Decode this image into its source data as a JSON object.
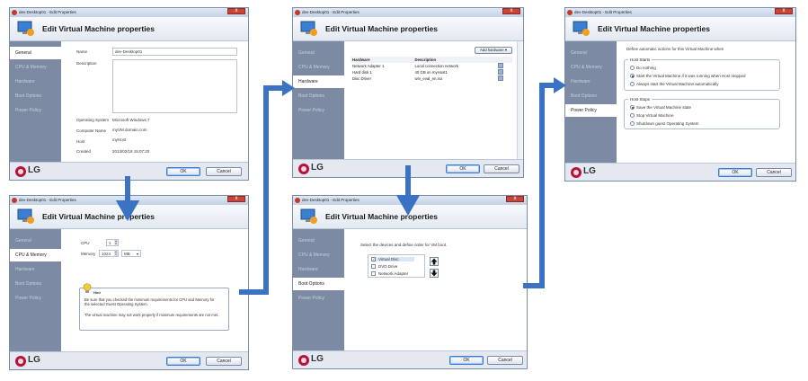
{
  "dialog": {
    "window_title": "dev-Desktop01 - Edit Properties",
    "heading": "Edit Virtual Machine properties",
    "ok_label": "OK",
    "cancel_label": "Cancel",
    "brand": "LG",
    "close_glyph": "x"
  },
  "sidebar": {
    "general": "General",
    "cpu_memory": "CPU & Memory",
    "hardware": "Hardware",
    "boot_options": "Boot Options",
    "power_policy": "Power Policy"
  },
  "general": {
    "name_label": "Name",
    "name_value": "dev-Desktop01",
    "description_label": "Description",
    "os_label": "Operating System",
    "os_value": "Microsoft Windows 7",
    "computer_name_label": "Computer Name",
    "computer_name_value": "myVM.domain.com",
    "host_label": "Host",
    "host_value": "myHost",
    "created_label": "Created",
    "created_value": "2013/02/18   15:07:20"
  },
  "hardware": {
    "add_button": "Add hardware",
    "col_hardware": "Hardware",
    "col_description": "Description",
    "rows": [
      {
        "hardware": "Network Adapter 1",
        "description": "Local connection network"
      },
      {
        "hardware": "Hard disk 1",
        "description": "40 GB on myHost1"
      },
      {
        "hardware": "Disc Driver",
        "description": "win_eval_en.iso"
      }
    ]
  },
  "power": {
    "intro": "Define automatic actions for this Virtual Machine when",
    "host_starts_title": "Host Starts",
    "host_starts_options": [
      {
        "label": "Do nothing",
        "selected": false
      },
      {
        "label": "Start the Virtual Machine if it was running when Host stopped",
        "selected": true
      },
      {
        "label": "Always start the Virtual Machine automatically",
        "selected": false
      }
    ],
    "host_stops_title": "Host Stops",
    "host_stops_options": [
      {
        "label": "Save the Virtual Machine state",
        "selected": true
      },
      {
        "label": "Stop Virtual Machine",
        "selected": false
      },
      {
        "label": "Shutdown guest Operating System",
        "selected": false
      }
    ]
  },
  "cpu": {
    "cpu_label": "CPU",
    "cpu_value": "1",
    "memory_label": "Memory",
    "memory_value": "1024",
    "memory_unit": "MB",
    "hint_title": "Hint",
    "hint_text1": "Be sure that you checked the minimum requirements for CPU and Memory for the selected Guest Operating System.",
    "hint_text2": "The virtual machine may not work properly if minimum requirements are not met."
  },
  "boot": {
    "instruction": "Select the devices and define order for VM boot.",
    "devices": [
      {
        "label": "Virtual Disc",
        "checked": true
      },
      {
        "label": "DVD Drive",
        "checked": false
      },
      {
        "label": "Network Adapter",
        "checked": false
      }
    ]
  },
  "colors": {
    "sidebar": "#7c8ba3",
    "arrow": "#3c72c3",
    "brand": "#b8123b"
  }
}
